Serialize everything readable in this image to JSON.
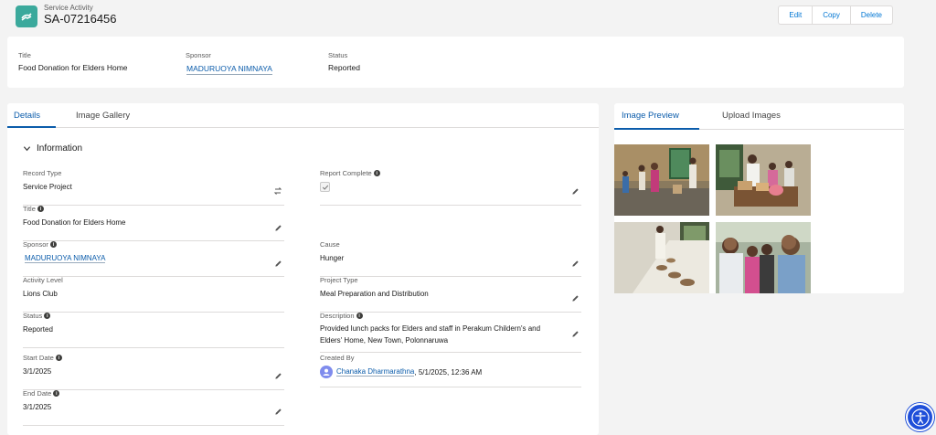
{
  "header": {
    "object_label": "Service Activity",
    "record_name": "SA-07216456",
    "actions": [
      "Edit",
      "Copy",
      "Delete"
    ]
  },
  "highlights": {
    "title_label": "Title",
    "title_value": "Food Donation for Elders Home",
    "sponsor_label": "Sponsor",
    "sponsor_value": "MADURUOYA NIMNAYA",
    "status_label": "Status",
    "status_value": "Reported"
  },
  "details": {
    "tabs": [
      "Details",
      "Image Gallery"
    ],
    "section_title": "Information",
    "fields": {
      "record_type": {
        "label": "Record Type",
        "value": "Service Project"
      },
      "report_complete": {
        "label": "Report Complete",
        "value": true
      },
      "title": {
        "label": "Title",
        "value": "Food Donation for Elders Home"
      },
      "sponsor": {
        "label": "Sponsor",
        "value": "MADURUOYA NIMNAYA"
      },
      "cause": {
        "label": "Cause",
        "value": "Hunger"
      },
      "activity_level": {
        "label": "Activity Level",
        "value": "Lions Club"
      },
      "project_type": {
        "label": "Project Type",
        "value": "Meal Preparation and Distribution"
      },
      "status": {
        "label": "Status",
        "value": "Reported"
      },
      "description": {
        "label": "Description",
        "value": "Provided lunch packs for Elders and staff in Perakum Childern's and Elders' Home, New Town, Polonnaruwa"
      },
      "start_date": {
        "label": "Start Date",
        "value": "3/1/2025"
      },
      "created_by": {
        "label": "Created By",
        "user": "Chanaka Dharmarathna",
        "timestamp": ", 5/1/2025, 12:36 AM"
      },
      "end_date": {
        "label": "End Date",
        "value": "3/1/2025"
      }
    }
  },
  "preview": {
    "tabs": [
      "Image Preview",
      "Upload Images"
    ]
  },
  "colors": {
    "brand_blue": "#0b5cab",
    "app_icon": "#3ba99c",
    "accessibility": "#1f4fd9"
  }
}
